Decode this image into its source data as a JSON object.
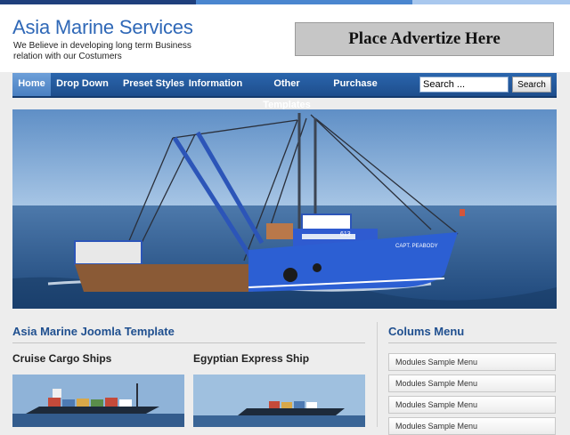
{
  "site": {
    "title": "Asia Marine Services",
    "tagline": "We Believe in developing long term Business relation with our Costumers",
    "ad_text": "Place Advertize Here"
  },
  "colors": {
    "brand": "#2f68b7",
    "nav": "#1e4e8c",
    "nav_active": "#5a8fcf",
    "heading": "#1f4f8f"
  },
  "nav": {
    "items": [
      {
        "label": "Home",
        "active": true
      },
      {
        "label": "Drop Down"
      },
      {
        "label": "Preset Styles"
      },
      {
        "label": "Information"
      },
      {
        "label": "Other Templates"
      },
      {
        "label": "Purchase"
      }
    ],
    "search_value": "Search ...",
    "search_button": "Search"
  },
  "main": {
    "title": "Asia Marine Joomla Template",
    "articles": [
      {
        "title": "Cruise Cargo Ships"
      },
      {
        "title": "Egyptian Express Ship"
      }
    ]
  },
  "sidebar": {
    "title": "Colums Menu",
    "items": [
      {
        "label": "Modules Sample Menu"
      },
      {
        "label": "Modules Sample Menu"
      },
      {
        "label": "Modules Sample Menu"
      },
      {
        "label": "Modules Sample Menu"
      }
    ]
  },
  "banner": {
    "boat_name": "CAPT. PEABODY",
    "hull_number": "613"
  }
}
